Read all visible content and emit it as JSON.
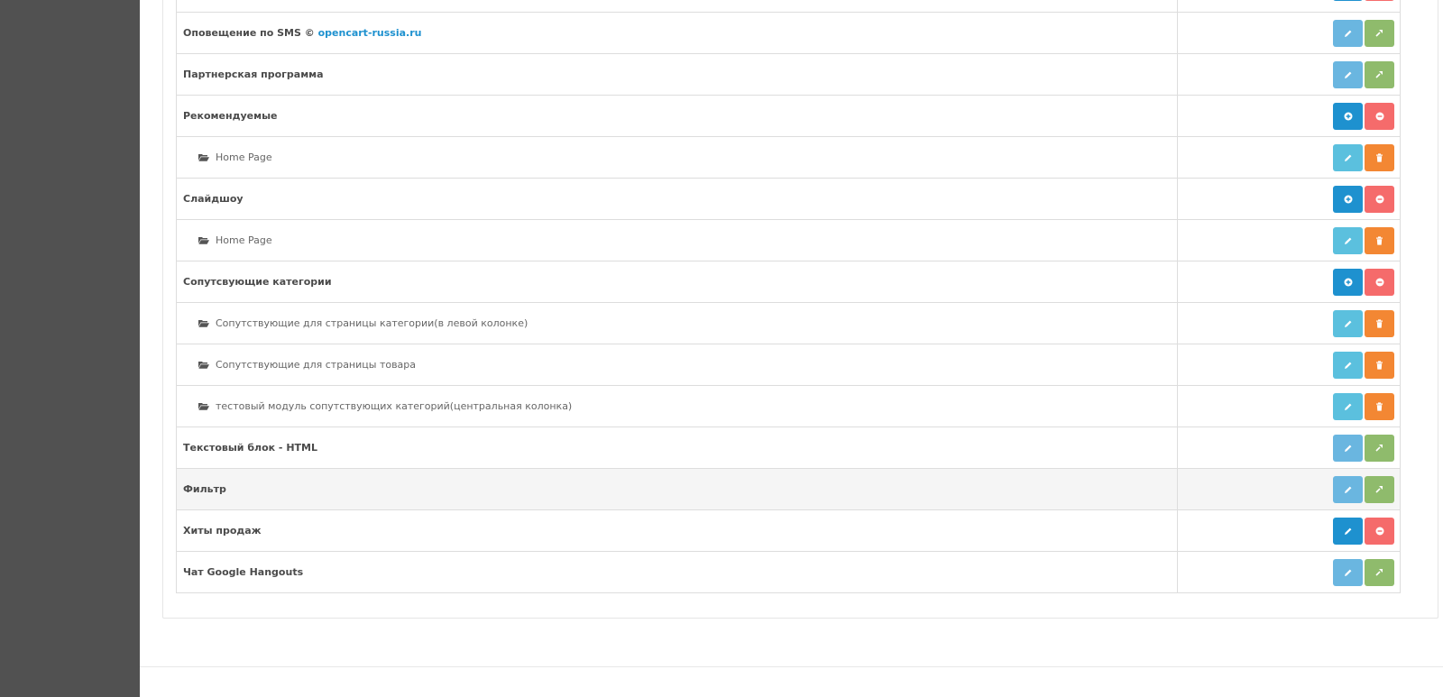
{
  "rows": [
    {
      "type": "parent",
      "label": "Оповещение по SMS © ",
      "link": "opencart-russia.ru",
      "buttons": [
        "edit-dim",
        "install"
      ]
    },
    {
      "type": "parent",
      "label": "Партнерская программа",
      "buttons": [
        "edit-dim",
        "install"
      ]
    },
    {
      "type": "parent",
      "label": "Рекомендуемые",
      "buttons": [
        "add",
        "uninstall"
      ]
    },
    {
      "type": "child",
      "label": "Home Page",
      "buttons": [
        "edit",
        "delete"
      ]
    },
    {
      "type": "parent",
      "label": "Слайдшоу",
      "buttons": [
        "add",
        "uninstall"
      ]
    },
    {
      "type": "child",
      "label": "Home Page",
      "buttons": [
        "edit",
        "delete"
      ]
    },
    {
      "type": "parent",
      "label": "Сопутсвующие категории",
      "buttons": [
        "add",
        "uninstall"
      ]
    },
    {
      "type": "child",
      "label": "Сопутствующие для страницы категории(в левой колонке)",
      "buttons": [
        "edit",
        "delete"
      ]
    },
    {
      "type": "child",
      "label": "Сопутствующие для страницы товара",
      "buttons": [
        "edit",
        "delete"
      ]
    },
    {
      "type": "child",
      "label": "тестовый модуль сопутствующих категорий(центральная колонка)",
      "buttons": [
        "edit",
        "delete"
      ]
    },
    {
      "type": "parent",
      "label": "Текстовый блок - HTML",
      "buttons": [
        "edit-dim",
        "install"
      ]
    },
    {
      "type": "parent",
      "label": "Фильтр",
      "buttons": [
        "edit-dim",
        "install"
      ],
      "hover": true
    },
    {
      "type": "parent",
      "label": "Хиты продаж",
      "buttons": [
        "edit-primary",
        "uninstall"
      ]
    },
    {
      "type": "parent",
      "label": "Чат Google Hangouts",
      "buttons": [
        "edit-dim",
        "install"
      ]
    }
  ],
  "colors": {
    "sidebar": "#515151",
    "info": "#5bc0de",
    "success": "#8fbb6c",
    "primary": "#1e91cf",
    "danger": "#f56b6b",
    "warning": "#f38733",
    "link": "#1e91cf"
  },
  "icons": {
    "edit": "pencil-icon",
    "install": "plug-icon",
    "add": "plus-circle-icon",
    "uninstall": "minus-circle-icon",
    "delete": "trash-icon",
    "folder": "folder-open-icon"
  }
}
